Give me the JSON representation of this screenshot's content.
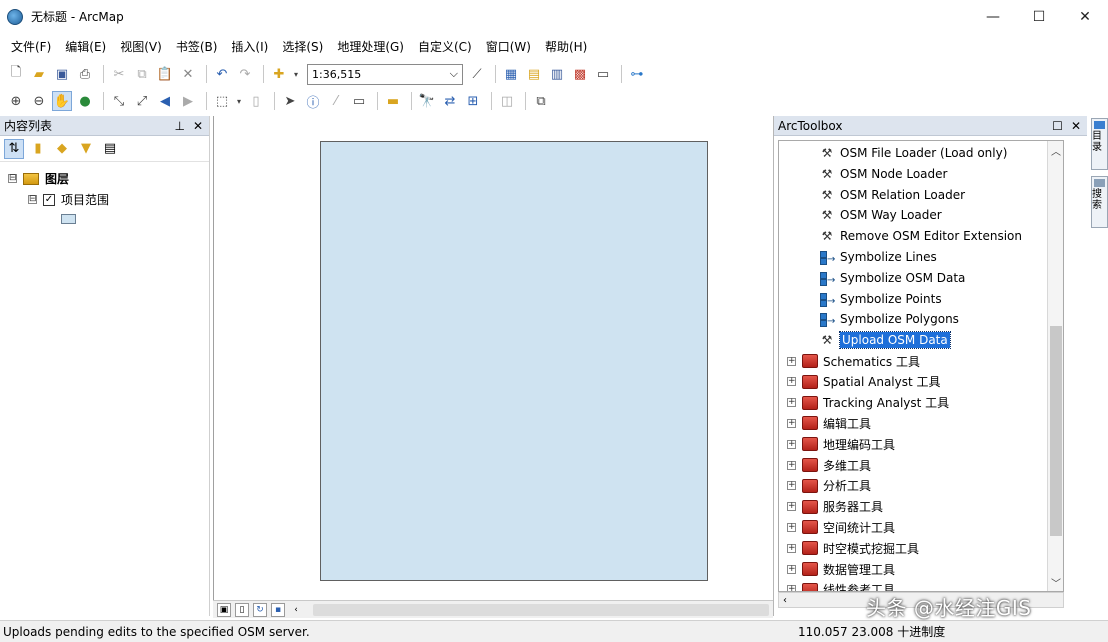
{
  "window": {
    "title": "无标题 - ArcMap",
    "controls": {
      "minimize": "—",
      "maximize": "☐",
      "close": "✕"
    }
  },
  "menubar": [
    "文件(F)",
    "编辑(E)",
    "视图(V)",
    "书签(B)",
    "插入(I)",
    "选择(S)",
    "地理处理(G)",
    "自定义(C)",
    "窗口(W)",
    "帮助(H)"
  ],
  "toolbar": {
    "scale_value": "1:36,515",
    "scale_dropdown_glyph": "⌵"
  },
  "toc": {
    "title": "内容列表",
    "pin_glyph": "⊥",
    "close_glyph": "✕",
    "layers_group": "图层",
    "layer_name": "项目范围",
    "layer_checked": "✓",
    "expand_glyph": "⊟"
  },
  "arctoolbox": {
    "title": "ArcToolbox",
    "tools": [
      {
        "label": "OSM File Loader (Load only)",
        "icon": "hammer-icon"
      },
      {
        "label": "OSM Node Loader",
        "icon": "hammer-icon"
      },
      {
        "label": "OSM Relation Loader",
        "icon": "hammer-icon"
      },
      {
        "label": "OSM Way Loader",
        "icon": "hammer-icon"
      },
      {
        "label": "Remove OSM Editor Extension",
        "icon": "hammer-icon"
      },
      {
        "label": "Symbolize Lines",
        "icon": "model-icon"
      },
      {
        "label": "Symbolize OSM Data",
        "icon": "model-icon"
      },
      {
        "label": "Symbolize Points",
        "icon": "model-icon"
      },
      {
        "label": "Symbolize Polygons",
        "icon": "model-icon"
      },
      {
        "label": "Upload OSM Data",
        "icon": "hammer-icon",
        "selected": true
      }
    ],
    "toolboxes": [
      "Schematics 工具",
      "Spatial Analyst 工具",
      "Tracking Analyst 工具",
      "编辑工具",
      "地理编码工具",
      "多维工具",
      "分析工具",
      "服务器工具",
      "空间统计工具",
      "时空模式挖掘工具",
      "数据管理工具",
      "线性参考工具"
    ]
  },
  "right_tabs": [
    "目录",
    "搜索"
  ],
  "status": {
    "message": "Uploads pending edits to the specified OSM server.",
    "coords": "110.057  23.008 十进制度"
  },
  "watermark": "头条 @水经注GIS",
  "colors": {
    "panel_header": "#dde4ee",
    "map_fill": "#cfe3f1",
    "selection": "#1e6fd9"
  }
}
